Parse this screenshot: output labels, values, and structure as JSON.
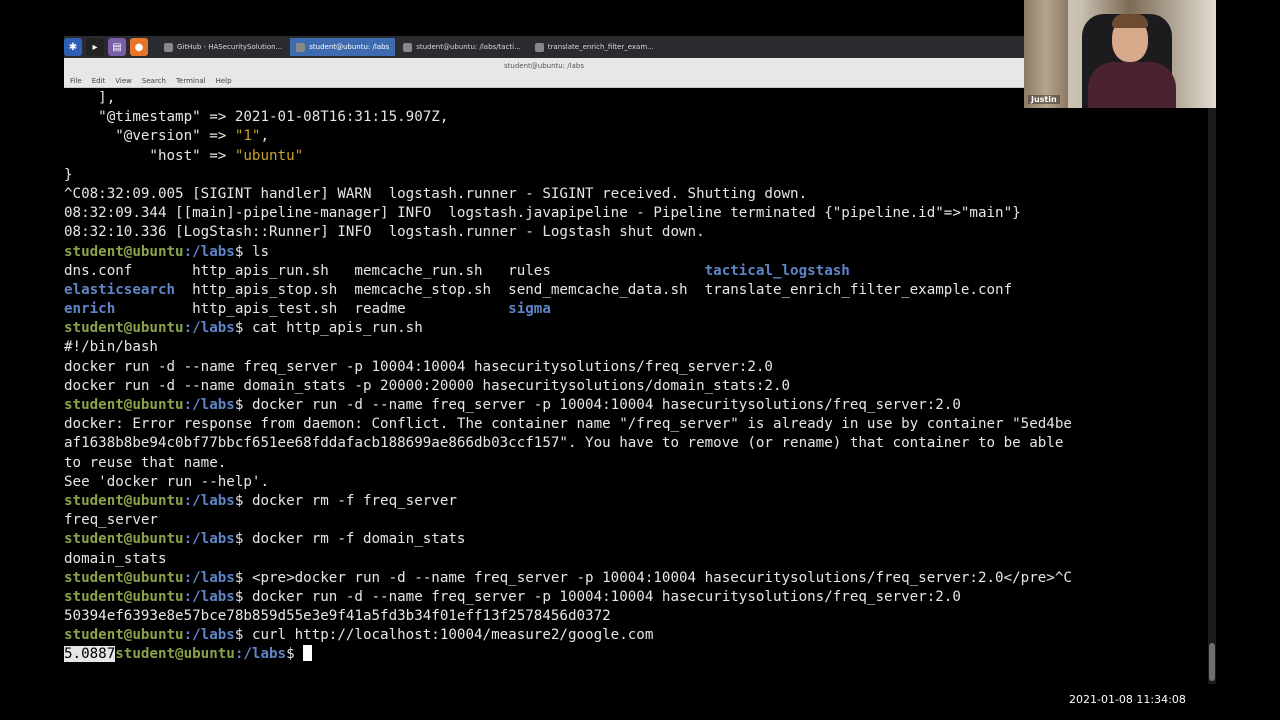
{
  "taskbar": {
    "launchers": [
      {
        "icon": "app-menu-icon",
        "glyph": "✱",
        "color": "#2e5fb4"
      },
      {
        "icon": "terminal-launcher-icon",
        "glyph": "▸",
        "color": "#222"
      },
      {
        "icon": "files-launcher-icon",
        "glyph": "▤",
        "color": "#7a5fa8"
      },
      {
        "icon": "firefox-launcher-icon",
        "glyph": "●",
        "color": "#e8752a"
      }
    ],
    "tasks": [
      {
        "label": "GitHub - HASecuritySolution...",
        "icon": "firefox-icon",
        "active": false
      },
      {
        "label": "student@ubuntu: /labs",
        "icon": "terminal-icon",
        "active": true
      },
      {
        "label": "student@ubuntu: /labs/tacti...",
        "icon": "terminal-icon",
        "active": false
      },
      {
        "label": "translate_enrich_filter_exam...",
        "icon": "vscode-icon",
        "active": false
      }
    ]
  },
  "window": {
    "title": "student@ubuntu: /labs"
  },
  "menu": [
    "File",
    "Edit",
    "View",
    "Search",
    "Terminal",
    "Help"
  ],
  "prompt": {
    "user": "student@ubuntu",
    "path": ":/labs",
    "symbol": "$ "
  },
  "terminal": {
    "l0": "    ],",
    "l1a": "    \"@timestamp\" => 2021-01-08T16:31:15.907Z,",
    "l2a": "      \"@version\" => ",
    "l2b": "\"1\"",
    "l2c": ",",
    "l3a": "          \"host\" => ",
    "l3b": "\"ubuntu\"",
    "l4": "}",
    "l5": "^C08:32:09.005 [SIGINT handler] WARN  logstash.runner - SIGINT received. Shutting down.",
    "l6": "08:32:09.344 [[main]-pipeline-manager] INFO  logstash.javapipeline - Pipeline terminated {\"pipeline.id\"=>\"main\"}",
    "l7": "08:32:10.336 [LogStash::Runner] INFO  logstash.runner - Logstash shut down.",
    "cmd_ls": "ls",
    "ls1a": "dns.conf       http_apis_run.sh   memcache_run.sh   rules                  ",
    "ls1b": "tactical_logstash",
    "ls2a": "elasticsearch",
    "ls2b": "  http_apis_stop.sh  memcache_stop.sh  send_memcache_data.sh  translate_enrich_filter_example.conf",
    "ls3a": "enrich",
    "ls3b": "         http_apis_test.sh  readme            ",
    "ls3c": "sigma",
    "cmd_cat": "cat http_apis_run.sh",
    "c1": "#!/bin/bash",
    "c2": "docker run -d --name freq_server -p 10004:10004 hasecuritysolutions/freq_server:2.0",
    "c3": "docker run -d --name domain_stats -p 20000:20000 hasecuritysolutions/domain_stats:2.0",
    "cmd_run1": "docker run -d --name freq_server -p 10004:10004 hasecuritysolutions/freq_server:2.0",
    "e1": "docker: Error response from daemon: Conflict. The container name \"/freq_server\" is already in use by container \"5ed4be",
    "e2": "af1638b8be94c0bf77bbcf651ee68fddafacb188699ae866db03ccf157\". You have to remove (or rename) that container to be able",
    "e3": "to reuse that name.",
    "e4": "See 'docker run --help'.",
    "cmd_rm1": "docker rm -f freq_server",
    "o_rm1": "freq_server",
    "cmd_rm2": "docker rm -f domain_stats",
    "o_rm2": "domain_stats",
    "cmd_pre": "<pre>docker run -d --name freq_server -p 10004:10004 hasecuritysolutions/freq_server:2.0</pre>^C",
    "cmd_run2": "docker run -d --name freq_server -p 10004:10004 hasecuritysolutions/freq_server:2.0",
    "o_run2": "50394ef6393e8e57bce78b859d55e3e9f41a5fd3b34f01eff13f2578456d0372",
    "cmd_curl": "curl http://localhost:10004/measure2/google.com",
    "o_curl": "5.0887"
  },
  "webcam": {
    "name": "Justin"
  },
  "clock": "2021-01-08 11:34:08",
  "colors": {
    "prompt_user": "#8aa34a",
    "prompt_path": "#5f84c7",
    "string": "#c9a227",
    "background": "#000000"
  }
}
